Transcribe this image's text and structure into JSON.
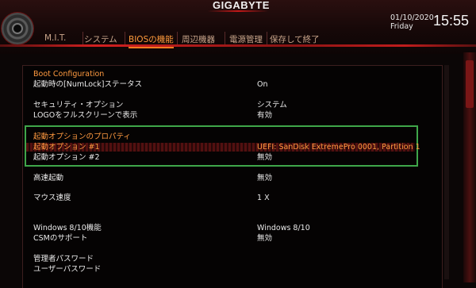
{
  "header": {
    "brand": "GIGABYTE",
    "date": "01/10/2020",
    "day": "Friday",
    "time": "15:55"
  },
  "tabs": [
    {
      "label": "M.I.T.",
      "active": false
    },
    {
      "label": "システム",
      "active": false
    },
    {
      "label": "BIOSの機能",
      "active": true
    },
    {
      "label": "周辺機器",
      "active": false
    },
    {
      "label": "電源管理",
      "active": false
    },
    {
      "label": "保存して終了",
      "active": false
    }
  ],
  "settings": {
    "boot_config_title": "Boot Configuration",
    "numlock_label": "起動時の[NumLock]ステータス",
    "numlock_value": "On",
    "security_label": "セキュリティ・オプション",
    "security_value": "システム",
    "logo_label": "LOGOをフルスクリーンで表示",
    "logo_value": "有効",
    "boot_priority_title": "起動オプションのプロパティ",
    "boot1_label": "起動オプション #1",
    "boot1_value": "UEFI: SanDisk ExtremePro 0001, Partition 1",
    "boot2_label": "起動オプション #2",
    "boot2_value": "無効",
    "fastboot_label": "高速起動",
    "fastboot_value": "無効",
    "mouse_label": "マウス速度",
    "mouse_value": "1 X",
    "win_label": "Windows 8/10機能",
    "win_value": "Windows 8/10",
    "csm_label": "CSMのサポート",
    "csm_value": "無効",
    "admin_pw_label": "管理者パスワード",
    "user_pw_label": "ユーザーパスワード"
  },
  "colors": {
    "accent": "#ff9a40",
    "highlight_box": "#3fa64a",
    "brand_red": "#d22020"
  }
}
